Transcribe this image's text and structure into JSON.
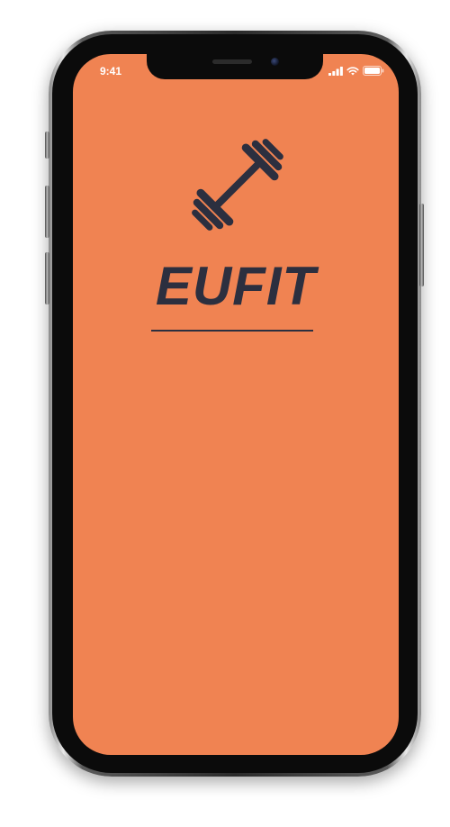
{
  "status_bar": {
    "time": "9:41"
  },
  "app": {
    "name": "EUFIT",
    "logo_icon": "barbell-icon"
  },
  "colors": {
    "screen_background": "#f08352",
    "logo_color": "#2c2f3f",
    "status_text": "#ffffff"
  }
}
